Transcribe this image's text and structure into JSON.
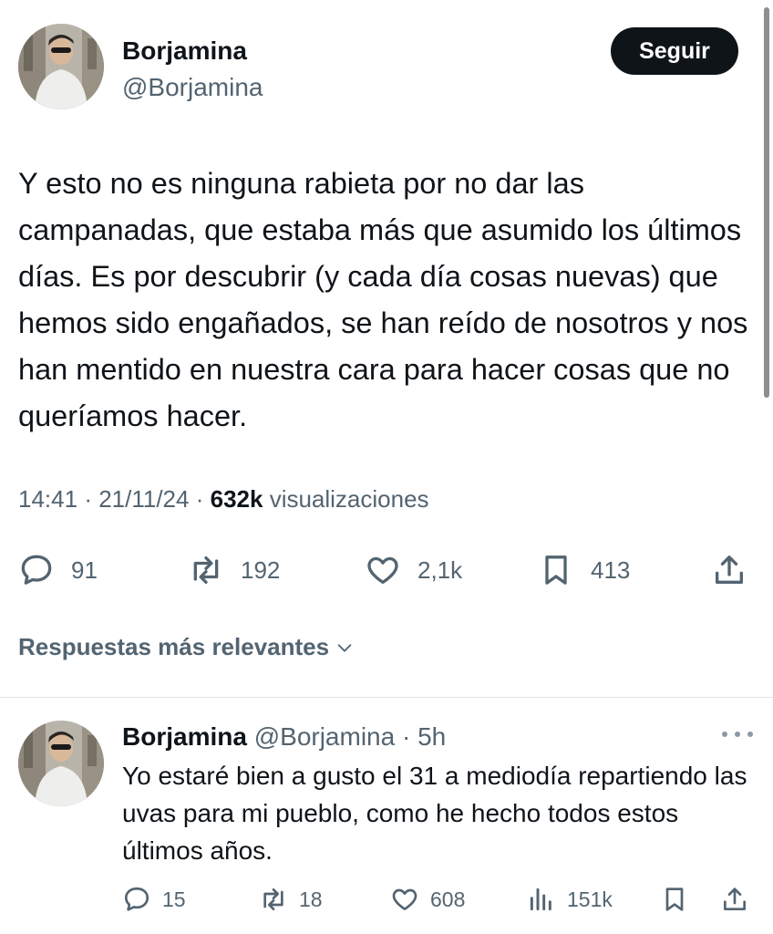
{
  "author": {
    "name": "Borjamina",
    "handle": "@Borjamina",
    "follow_label": "Seguir"
  },
  "tweet": {
    "text": "Y esto no es ninguna rabieta por no dar las campanadas, que estaba más que asumido los últimos días. Es por descubrir (y cada día cosas nuevas) que hemos sido engañados, se han reído de nosotros y nos han mentido en nuestra cara para hacer cosas que no queríamos hacer.",
    "time": "14:41",
    "date": "21/11/24",
    "views_count": "632k",
    "views_label": "visualizaciones",
    "stats": {
      "replies": "91",
      "retweets": "192",
      "likes": "2,1k",
      "bookmarks": "413"
    }
  },
  "replies_sort_label": "Respuestas más relevantes",
  "reply": {
    "name": "Borjamina",
    "handle": "@Borjamina",
    "age": "5h",
    "text": "Yo estaré bien a gusto el 31 a mediodía repartiendo las uvas para mi pueblo, como he hecho todos estos últimos años.",
    "stats": {
      "replies": "15",
      "retweets": "18",
      "likes": "608",
      "views": "151k"
    }
  },
  "icons": {
    "reply": "speech-bubble-icon",
    "retweet": "retweet-arrows-icon",
    "like": "heart-outline-icon",
    "bookmark": "bookmark-icon",
    "share": "share-upload-icon",
    "views": "bar-chart-icon",
    "more": "more-dots-icon",
    "sort": "chevron-down-icon"
  },
  "colors": {
    "text_primary": "#0f1419",
    "text_secondary": "#536471",
    "follow_bg": "#0f1419",
    "follow_text": "#ffffff"
  }
}
